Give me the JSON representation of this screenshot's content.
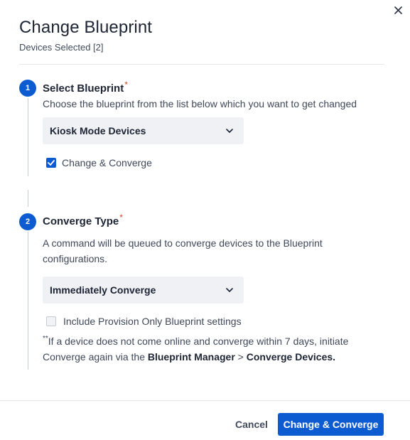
{
  "dialog": {
    "title": "Change Blueprint",
    "subtitle": "Devices Selected [2]",
    "close_icon": "close-icon"
  },
  "steps": [
    {
      "number": "1",
      "title": "Select Blueprint",
      "required_mark": "*",
      "description": "Choose the blueprint from the list below which you want to get changed",
      "select_value": "Kiosk Mode Devices",
      "checkbox_label": "Change & Converge",
      "checkbox_checked": true
    },
    {
      "number": "2",
      "title": "Converge Type",
      "required_mark": "*",
      "description_line1": "A command will be queued to converge devices to the Blueprint",
      "description_line2": "configurations.",
      "select_value": "Immediately Converge",
      "checkbox_label": "Include Provision Only Blueprint settings",
      "checkbox_checked": false
    }
  ],
  "note": {
    "marker": "**",
    "text_part1": "If a device does not come online and converge within 7 days, initiate Converge again via the ",
    "bold1": "Blueprint Manager",
    "separator": " > ",
    "bold2": "Converge Devices."
  },
  "footer": {
    "cancel_label": "Cancel",
    "primary_label": "Change & Converge"
  },
  "colors": {
    "primary": "#0d5bd1",
    "required": "#e0462f"
  }
}
